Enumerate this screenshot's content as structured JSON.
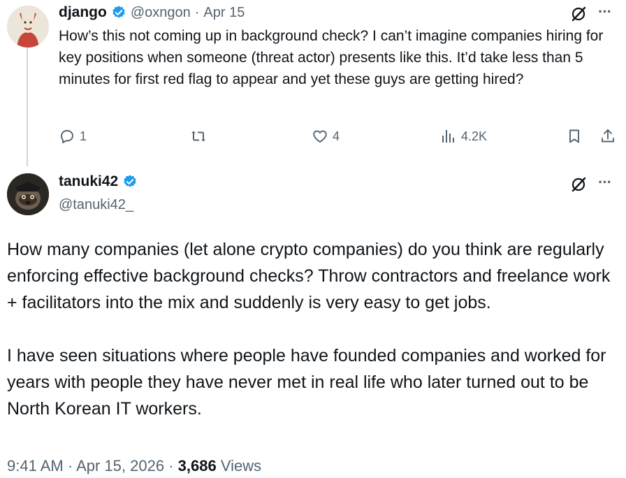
{
  "reply": {
    "name": "django",
    "handle": "@oxngon",
    "dot": "·",
    "date": "Apr 15",
    "text": "How’s this not coming up in background check? I can’t imagine companies hiring for key positions when someone (threat actor) presents like this. It’d take less than 5 minutes for first red flag to appear and yet these guys are getting hired?",
    "actions": {
      "replies": "1",
      "likes": "4",
      "views": "4.2K"
    },
    "more": "···"
  },
  "main": {
    "name": "tanuki42",
    "handle": "@tanuki42_",
    "more": "···",
    "paragraphs": [
      "How many companies (let alone crypto companies) do you think are regularly enforcing effective background checks? Throw contractors and freelance work + facilitators into the mix and suddenly is very easy to get jobs.",
      "I have seen situations where people have founded companies and worked for years with people they have never met in real life who later turned out to be North Korean IT workers."
    ],
    "footer": {
      "time": "9:41 AM",
      "sep1": "·",
      "date": "Apr 15, 2026",
      "sep2": "·",
      "views_count": "3,686",
      "views_label": "Views"
    }
  },
  "colors": {
    "verified": "#1d9bf0",
    "text": "#0f1419",
    "secondary": "#536471",
    "thread_line": "#cfd9de"
  }
}
